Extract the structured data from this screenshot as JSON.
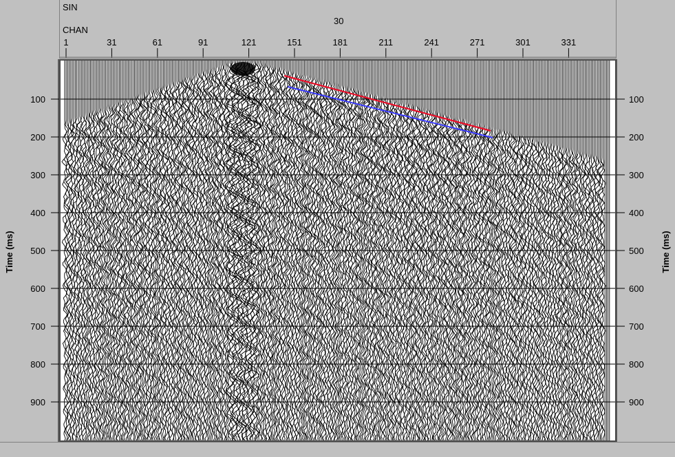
{
  "header": {
    "line1_label": "SIN",
    "line1_value": "30",
    "line2_label": "CHAN",
    "channel_ticks": [
      "1",
      "31",
      "61",
      "91",
      "121",
      "151",
      "181",
      "211",
      "241",
      "271",
      "301",
      "331"
    ]
  },
  "axes": {
    "y_label": "Time (ms)",
    "time_ticks": [
      "100",
      "200",
      "300",
      "400",
      "500",
      "600",
      "700",
      "800",
      "900"
    ],
    "time_range_ms": [
      0,
      1000
    ],
    "channel_range": [
      1,
      360
    ]
  },
  "picks": {
    "red_line_color": "#e8102a",
    "blue_line_color": "#3a3aff"
  },
  "colors": {
    "background": "#c0c0c0",
    "trace_ink": "#000000",
    "grid": "#000000"
  }
}
